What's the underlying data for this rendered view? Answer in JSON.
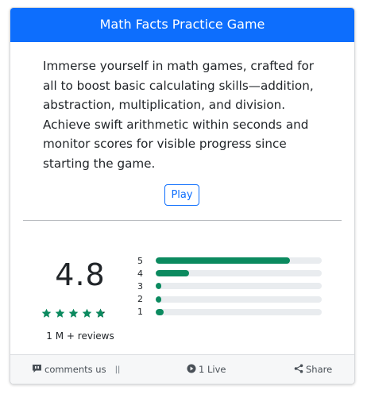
{
  "header": {
    "title": "Math Facts Practice Game",
    "color": "#0d6efd"
  },
  "description": "Immerse yourself in math games, crafted for all to boost basic calculating skills—addition, abstraction, multiplication, and division. Achieve swift arithmetic within seconds and monitor scores for visible progress since starting the game.",
  "play_button": {
    "label": "Play"
  },
  "rating": {
    "average": "4.8",
    "stars": 4.8,
    "star_color": "#0b8a5f",
    "reviews_label": "1 M + reviews",
    "breakdown": [
      {
        "label": "5",
        "fraction": 0.81
      },
      {
        "label": "4",
        "fraction": 0.2
      },
      {
        "label": "3",
        "fraction": 0.02
      },
      {
        "label": "2",
        "fraction": 0.015
      },
      {
        "label": "1",
        "fraction": 0.05
      }
    ],
    "bar_color": "#0b8a5f"
  },
  "footer": {
    "comments_label": "comments us",
    "separator": "||",
    "live_label": "1 Live",
    "share_label": "Share"
  }
}
